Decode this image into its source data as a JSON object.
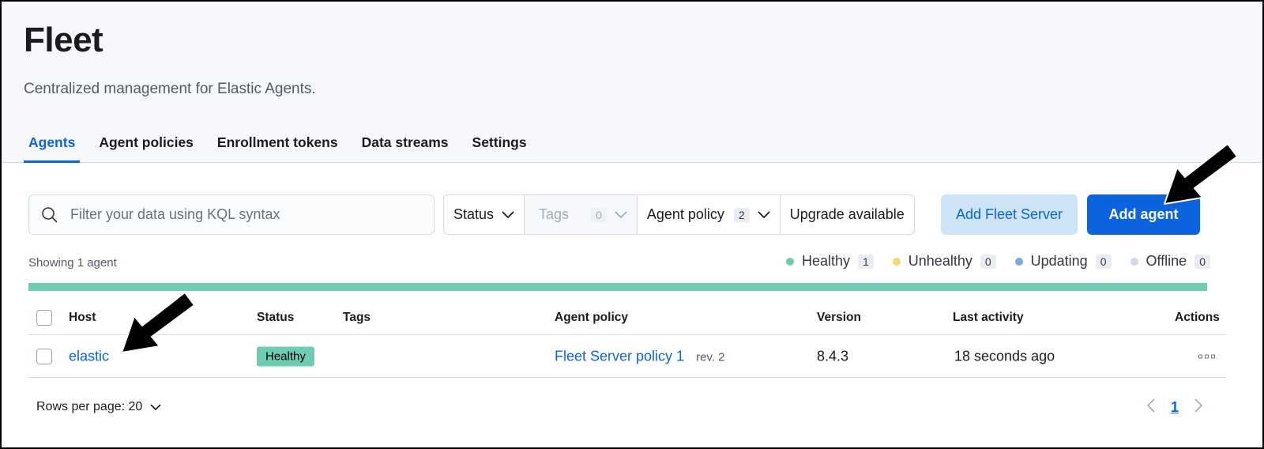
{
  "header": {
    "title": "Fleet",
    "subtitle": "Centralized management for Elastic Agents."
  },
  "tabs": [
    {
      "label": "Agents",
      "active": true
    },
    {
      "label": "Agent policies",
      "active": false
    },
    {
      "label": "Enrollment tokens",
      "active": false
    },
    {
      "label": "Data streams",
      "active": false
    },
    {
      "label": "Settings",
      "active": false
    }
  ],
  "toolbar": {
    "search_placeholder": "Filter your data using KQL syntax",
    "status_label": "Status",
    "tags_label": "Tags",
    "tags_count": "0",
    "agent_policy_label": "Agent policy",
    "agent_policy_count": "2",
    "upgrade_label": "Upgrade available",
    "add_fleet_server_label": "Add Fleet Server",
    "add_agent_label": "Add agent"
  },
  "summary": {
    "showing": "Showing 1 agent",
    "legend": [
      {
        "label": "Healthy",
        "count": "1",
        "color": "#6dccb1"
      },
      {
        "label": "Unhealthy",
        "count": "0",
        "color": "#f1d86f"
      },
      {
        "label": "Updating",
        "count": "0",
        "color": "#79aad9"
      },
      {
        "label": "Offline",
        "count": "0",
        "color": "#d3dae6"
      }
    ],
    "health_bar_color": "#6dccb1"
  },
  "table": {
    "columns": {
      "host": "Host",
      "status": "Status",
      "tags": "Tags",
      "policy": "Agent policy",
      "version": "Version",
      "last_activity": "Last activity",
      "actions": "Actions"
    },
    "rows": [
      {
        "host": "elastic",
        "status": "Healthy",
        "policy": "Fleet Server policy 1",
        "revision": "rev. 2",
        "version": "8.4.3",
        "last_activity": "18 seconds ago"
      }
    ]
  },
  "footer": {
    "rows_per_page": "Rows per page: 20",
    "current_page": "1"
  },
  "colors": {
    "accent": "#0b64dd",
    "healthy": "#6dccb1"
  }
}
